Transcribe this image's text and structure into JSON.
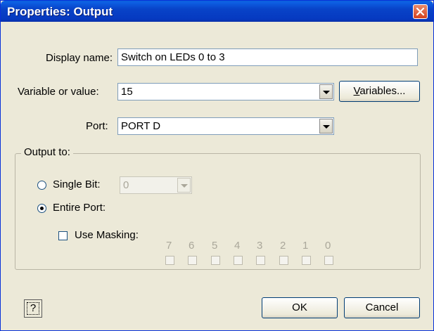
{
  "window": {
    "title": "Properties: Output"
  },
  "fields": {
    "display_name_label": "Display name:",
    "display_name_value": "Switch on LEDs 0 to 3",
    "variable_label": "Variable or value:",
    "variable_value": "15",
    "variables_button": "Variables...",
    "port_label": "Port:",
    "port_value": "PORT D"
  },
  "output_to": {
    "group_label": "Output to:",
    "single_bit_label": "Single Bit:",
    "single_bit_selected": false,
    "single_bit_value": "0",
    "entire_port_label": "Entire Port:",
    "entire_port_selected": true,
    "use_masking_label": "Use Masking:",
    "use_masking_checked": false,
    "bits": [
      "7",
      "6",
      "5",
      "4",
      "3",
      "2",
      "1",
      "0"
    ]
  },
  "buttons": {
    "help": "?",
    "ok": "OK",
    "cancel": "Cancel"
  },
  "icons": {
    "close": "close-icon",
    "dropdown": "chevron-down-icon"
  },
  "colors": {
    "titlebar": "#0843c8",
    "close_button": "#d4421f",
    "dialog_background": "#ece9d8"
  }
}
